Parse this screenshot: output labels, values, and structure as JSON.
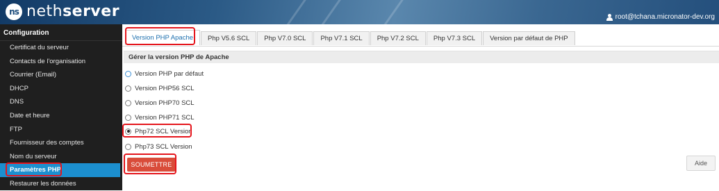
{
  "header": {
    "brand_thin": "neth",
    "brand_bold": "server",
    "logo_mark": "ns",
    "user": "root@tchana.micronator-dev.org"
  },
  "sidebar": {
    "heading": "Configuration",
    "items": [
      {
        "label": "Certificat du serveur"
      },
      {
        "label": "Contacts de l'organisation"
      },
      {
        "label": "Courrier (Email)"
      },
      {
        "label": "DHCP"
      },
      {
        "label": "DNS"
      },
      {
        "label": "Date et heure"
      },
      {
        "label": "FTP"
      },
      {
        "label": "Fournisseur des comptes"
      },
      {
        "label": "Nom du serveur"
      },
      {
        "label": "Paramètres PHP"
      },
      {
        "label": "Restaurer les données"
      }
    ],
    "active_index": 9
  },
  "tabs": [
    {
      "label": "Version PHP Apache"
    },
    {
      "label": "Php V5.6 SCL"
    },
    {
      "label": "Php V7.0 SCL"
    },
    {
      "label": "Php V7.1 SCL"
    },
    {
      "label": "Php V7.2 SCL"
    },
    {
      "label": "Php V7.3 SCL"
    },
    {
      "label": "Version par défaut de PHP"
    }
  ],
  "panel": {
    "title": "Gérer la version PHP de Apache",
    "options": [
      {
        "label": "Version PHP par défaut",
        "checked": false
      },
      {
        "label": "Version PHP56 SCL",
        "checked": false
      },
      {
        "label": "Version PHP70 SCL",
        "checked": false
      },
      {
        "label": "Version PHP71 SCL",
        "checked": false
      },
      {
        "label": "Php72 SCL Version",
        "checked": true
      },
      {
        "label": "Php73 SCL Version",
        "checked": false
      }
    ],
    "submit_label": "SOUMETTRE",
    "help_label": "Aide"
  },
  "colors": {
    "highlight": "#e5141b",
    "accent": "#1c8fcf",
    "submit": "#d94c3a"
  }
}
